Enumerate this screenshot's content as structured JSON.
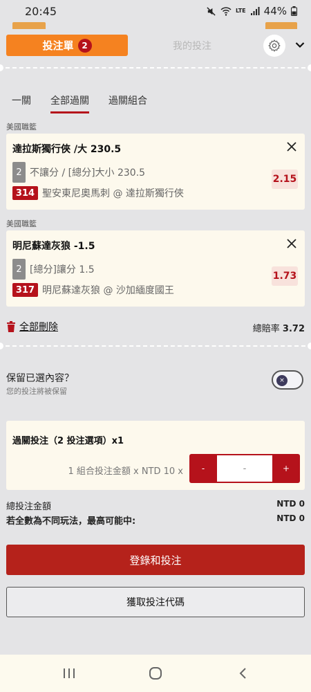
{
  "status_bar": {
    "time": "20:45",
    "battery": "44%",
    "network": "LTE"
  },
  "header": {
    "betslip_label": "投注單",
    "betslip_count": "2",
    "mybets_label": "我的投注"
  },
  "subtabs": [
    {
      "label": "一關",
      "active": false
    },
    {
      "label": "全部過關",
      "active": true
    },
    {
      "label": "過關組合",
      "active": false
    }
  ],
  "bets": [
    {
      "league": "美國職籃",
      "title": "達拉斯獨行俠 /大 230.5",
      "count": "2",
      "market": "不讓分 / [總分]大小 230.5",
      "match_no": "314",
      "match": "聖安東尼奧馬刺 @ 達拉斯獨行俠",
      "odds": "2.15"
    },
    {
      "league": "美國職籃",
      "title": "明尼蘇達灰狼 -1.5",
      "count": "2",
      "market": "[總分]讓分 1.5",
      "match_no": "317",
      "match": "明尼蘇達灰狼 @ 沙加緬度國王",
      "odds": "1.73"
    }
  ],
  "delete_all": "全部刪除",
  "total_odds": {
    "label": "總賠率",
    "value": "3.72"
  },
  "keep": {
    "title": "保留已選內容？",
    "subtitle": "您的投注將被保留",
    "toggle_on": false,
    "toggle_symbol": "×"
  },
  "parlay": {
    "title": "過關投注（2 投注選項）x1",
    "stake_label": "1 組合投注金額 x NTD 10 x",
    "minus": "-",
    "value": "-",
    "plus": "+"
  },
  "summary": {
    "total_stake_label": "總投注金額",
    "total_stake_value": "NTD 0",
    "max_win_label": "若全數為不同玩法，最高可能中:",
    "max_win_value": "NTD 0"
  },
  "buttons": {
    "login_bet": "登錄和投注",
    "get_code": "獲取投注代碼"
  },
  "colors": {
    "accent_orange": "#f58220",
    "accent_red": "#b5121b",
    "card_bg": "#fdf9ed",
    "page_bg": "#e4e4e6"
  },
  "icons": [
    "mute-icon",
    "wifi-icon",
    "signal-icon",
    "battery-icon",
    "gear-icon",
    "chevron-down-icon",
    "close-icon",
    "trash-icon",
    "recents-icon",
    "home-icon",
    "back-icon"
  ]
}
